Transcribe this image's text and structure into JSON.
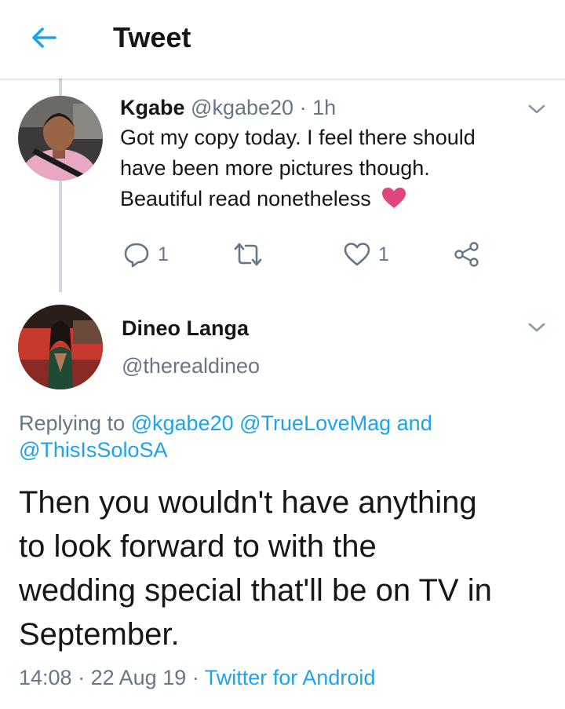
{
  "header": {
    "title": "Tweet",
    "back_icon": "arrow-left-icon",
    "accent_color": "#1da1f2"
  },
  "parent_tweet": {
    "display_name": "Kgabe",
    "handle": "@kgabe20",
    "separator": "·",
    "time": "1h",
    "text_lines": [
      "Got my copy today. I feel there should",
      "have been more pictures though.",
      "Beautiful read nonetheless"
    ],
    "emoji": "❤",
    "reply_count": "1",
    "like_count": "1",
    "icons": [
      "reply-icon",
      "retweet-icon",
      "like-icon",
      "share-icon",
      "chevron-down-icon"
    ]
  },
  "main_tweet": {
    "display_name": "Dineo Langa",
    "handle": "@therealdineo",
    "replying_prefix": "Replying to",
    "replying_to": [
      "@kgabe20",
      "@TrueLoveMag",
      "@ThisIsSoloSA"
    ],
    "replying_and": "and",
    "text_lines": [
      "Then you wouldn't have anything",
      "to look forward to with the",
      "wedding special that'll be on TV in",
      "September."
    ],
    "time": "14:08",
    "date": "22 Aug 19",
    "separator": "·",
    "source": "Twitter for Android"
  }
}
